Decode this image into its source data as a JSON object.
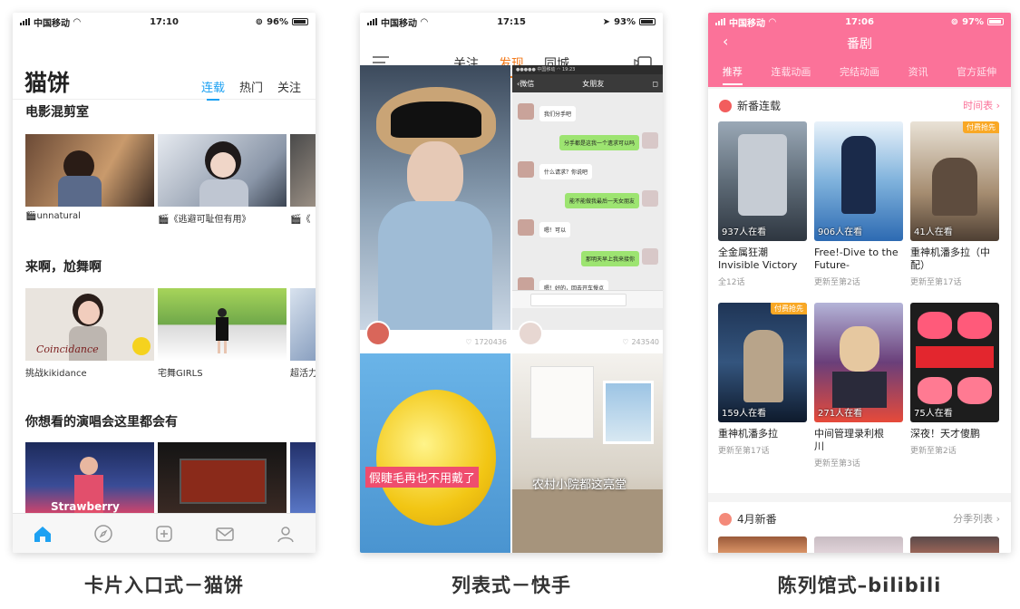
{
  "captions": [
    "卡片入口式－猫饼",
    "列表式－快手",
    "陈列馆式–bilibili"
  ],
  "maobing": {
    "status": {
      "carrier": "中国移动",
      "time": "17:10",
      "battery": "96%"
    },
    "title": "猫饼",
    "tabs": [
      "连载",
      "热门",
      "关注"
    ],
    "sections": [
      {
        "title": "电影混剪室",
        "cards": [
          "unnatural",
          "《逃避可耻但有用》",
          "《"
        ]
      },
      {
        "title": "来啊，尬舞啊",
        "cards": [
          "挑战kikidance",
          "宅舞GIRLS",
          "超活力"
        ],
        "overlay": "Coincidance"
      },
      {
        "title": "你想看的演唱会这里都会有",
        "cards": [
          "",
          "",
          ""
        ],
        "overlay": "Strawberry"
      }
    ],
    "nav": [
      "home-icon",
      "compass-icon",
      "plus-icon",
      "mail-icon",
      "profile-icon"
    ]
  },
  "kuaishou": {
    "status": {
      "carrier": "中国移动",
      "time": "17:15",
      "battery": "93%"
    },
    "tabs": [
      "关注",
      "发现",
      "同城"
    ],
    "tiles": [
      {
        "likes": "1720436"
      },
      {
        "likes": "243540"
      },
      {
        "subtitle": "假睫毛再也不用戴了"
      },
      {
        "subtitle": "农村小院都这亮堂"
      }
    ],
    "chat": {
      "header_back": "微信",
      "header_title": "女朋友",
      "messages": [
        {
          "side": "in",
          "text": "我们分手吧"
        },
        {
          "side": "out",
          "text": "分手都是这我一个遗求可以吗"
        },
        {
          "side": "in",
          "text": "什么请求？你说吧"
        },
        {
          "side": "out",
          "text": "能不能做我最后一天女朋友"
        },
        {
          "side": "in",
          "text": "嗯！可以"
        },
        {
          "side": "out",
          "text": "那明天早上我来接你"
        },
        {
          "side": "in",
          "text": "嗯！好的，回去开车慢点"
        }
      ]
    }
  },
  "bilibili": {
    "status": {
      "carrier": "中国移动",
      "time": "17:06",
      "battery": "97%"
    },
    "title": "番剧",
    "tabs": [
      "推荐",
      "连载动画",
      "完结动画",
      "资讯",
      "官方延伸"
    ],
    "section1": {
      "title": "新番连载",
      "more": "时间表"
    },
    "section2": {
      "title": "4月新番",
      "more": "分季列表"
    },
    "posters": [
      {
        "watch": "937人在看",
        "title": "全金属狂潮 Invisible Victory",
        "sub": "全12话",
        "pay": "",
        "color": "#5f6c78"
      },
      {
        "watch": "906人在看",
        "title": "Free!-Dive to the Future-",
        "sub": "更新至第2话",
        "pay": "",
        "color": "#3c88c9"
      },
      {
        "watch": "41人在看",
        "title": "重神机潘多拉（中配）",
        "sub": "更新至第17话",
        "pay": "付费抢先",
        "color": "#7a6a5a"
      },
      {
        "watch": "159人在看",
        "title": "重神机潘多拉",
        "sub": "更新至第17话",
        "pay": "付费抢先",
        "color": "#2c4a6e"
      },
      {
        "watch": "271人在看",
        "title": "中间管理录利根川",
        "sub": "更新至第3话",
        "pay": "",
        "color": "#6a3f7a"
      },
      {
        "watch": "75人在看",
        "title": "深夜！天才傻鹏",
        "sub": "更新至第2话",
        "pay": "",
        "color": "#d63a3a"
      }
    ]
  },
  "colors": {
    "maobing_accent": "#1da1f2",
    "kuaishou_accent": "#f37b1d",
    "bili_pink": "#fb7299"
  }
}
